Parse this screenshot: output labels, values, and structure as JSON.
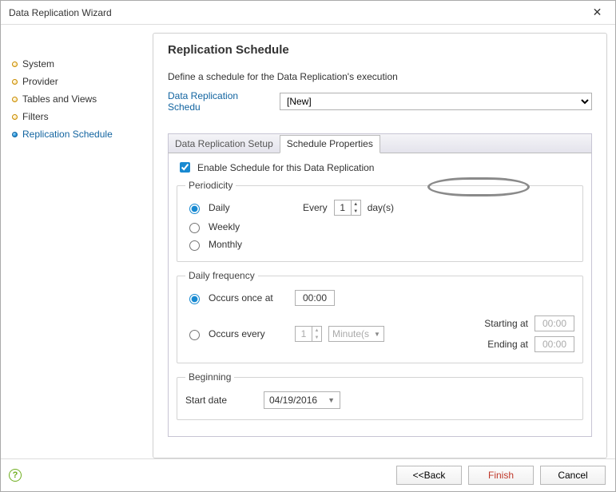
{
  "window": {
    "title": "Data Replication Wizard"
  },
  "sidebar": {
    "items": [
      {
        "label": "System"
      },
      {
        "label": "Provider"
      },
      {
        "label": "Tables and Views"
      },
      {
        "label": "Filters"
      },
      {
        "label": "Replication Schedule"
      }
    ]
  },
  "page": {
    "heading": "Replication Schedule",
    "subtitle": "Define a schedule for the Data Replication's execution",
    "schedule_label": "Data Replication Schedu",
    "schedule_value": "[New]"
  },
  "tabs": {
    "setup": "Data Replication Setup",
    "props": "Schedule Properties"
  },
  "props": {
    "enable_label": "Enable Schedule for this Data Replication",
    "periodicity": {
      "legend": "Periodicity",
      "daily": "Daily",
      "weekly": "Weekly",
      "monthly": "Monthly",
      "every": "Every",
      "spin_value": "1",
      "days_suffix": "day(s)"
    },
    "daily_freq": {
      "legend": "Daily frequency",
      "once_at": "Occurs once at",
      "once_time": "00:00",
      "every": "Occurs every",
      "every_value": "1",
      "unit": "Minute(s",
      "starting_at": "Starting at",
      "starting_time": "00:00",
      "ending_at": "Ending at",
      "ending_time": "00:00"
    },
    "beginning": {
      "legend": "Beginning",
      "start_date_label": "Start date",
      "start_date": "04/19/2016"
    }
  },
  "footer": {
    "back": "<<Back",
    "finish": "Finish",
    "cancel": "Cancel"
  }
}
